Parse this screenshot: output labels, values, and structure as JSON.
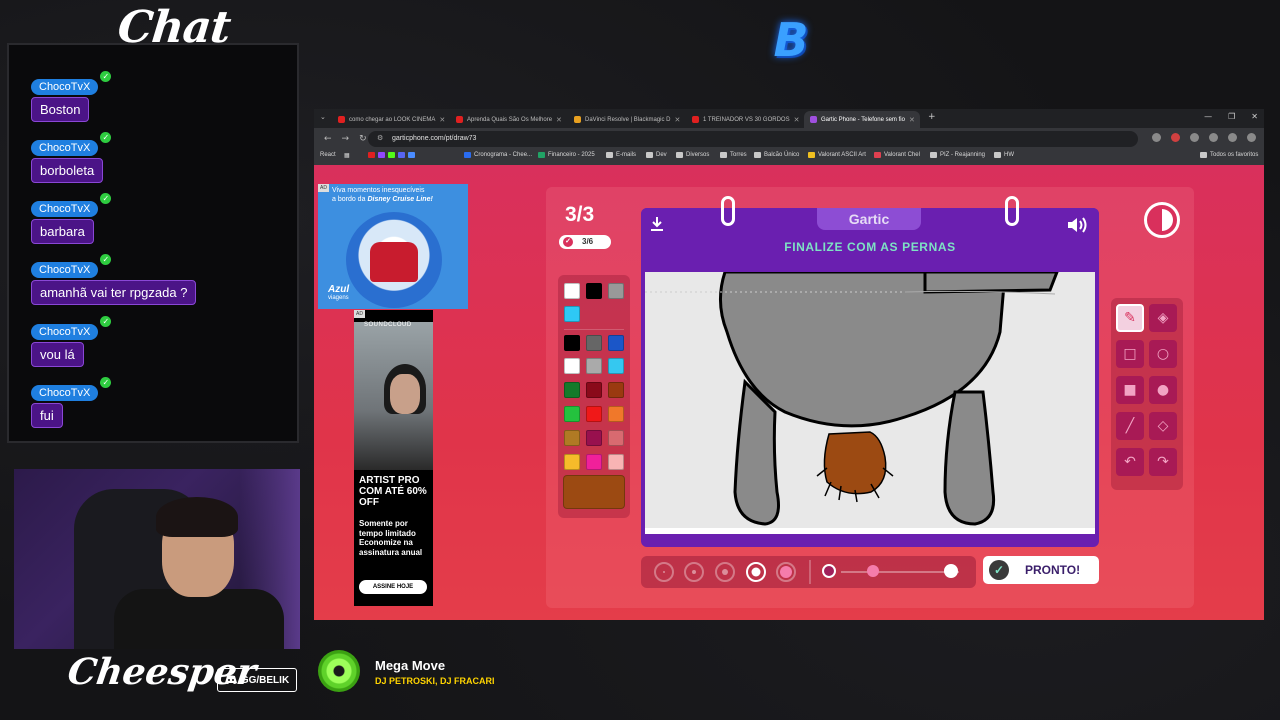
{
  "overlay": {
    "chat_title": "Chat",
    "streamer_name": "Cheesper",
    "discord_label": "GG/BELIK",
    "logo_letter": "B",
    "now_playing": {
      "title": "Mega Move",
      "artist": "DJ PETROSKI, DJ FRACARI"
    }
  },
  "chat": {
    "messages": [
      {
        "user": "ChocoTvX",
        "text": "Boston"
      },
      {
        "user": "ChocoTvX",
        "text": "borboleta"
      },
      {
        "user": "ChocoTvX",
        "text": "barbara"
      },
      {
        "user": "ChocoTvX",
        "text": "amanhã vai ter rpgzada ?"
      },
      {
        "user": "ChocoTvX",
        "text": "vou lá"
      },
      {
        "user": "ChocoTvX",
        "text": "fui"
      }
    ]
  },
  "browser": {
    "tabs": [
      {
        "label": "como chegar ao LOOK CINEMA",
        "favicon_color": "#e02020"
      },
      {
        "label": "Aprenda Quais São Os Melhore",
        "favicon_color": "#e02020"
      },
      {
        "label": "DaVinci Resolve | Blackmagic D",
        "favicon_color": "#e8a020"
      },
      {
        "label": "1 TREINADOR VS 30 GORDOS",
        "favicon_color": "#e02020"
      },
      {
        "label": "Gartic Phone - Telefone sem fio",
        "favicon_color": "#a050e0",
        "active": true
      }
    ],
    "url": "garticphone.com/pt/draw73",
    "bookmarks": [
      "React",
      "Cronograma - Chee...",
      "Financeiro - 2025",
      "E-mails",
      "Dev",
      "Diversos",
      "Torres",
      "Balcão Único",
      "Valorant ASCII Art",
      "Valorant Chel",
      "PIZ - Reajanning",
      "HW",
      "Todos os favoritos"
    ]
  },
  "ads": {
    "ad_tag": "AD",
    "cruise": {
      "text_line1": "Viva momentos inesquecíveis",
      "text_line2": "a bordo da",
      "text_brand": "Disney Cruise Line!",
      "logo_line1": "Azul",
      "logo_line2": "viagens"
    },
    "soundcloud": {
      "brand": "SOUNDCLOUD",
      "headline": "ARTIST PRO COM ATÉ 60% OFF",
      "sub": "Somente por tempo limitado Economize na assinatura anual",
      "cta": "ASSINE HOJE"
    }
  },
  "game": {
    "round": "3/3",
    "progress": "3/6",
    "brand": "Gartic",
    "prompt": "FINALIZE COM AS PERNAS",
    "ready_label": "PRONTO!",
    "palette": [
      "#ffffff",
      "#000000",
      "#999999",
      "#2ec8f5",
      "#000000",
      "#666666",
      "#1b56c8",
      "#ffffff",
      "#aaaaaa",
      "#35c8f0",
      "#147a2a",
      "#8a0a1a",
      "#9a3a10",
      "#24c23e",
      "#f01818",
      "#f0782a",
      "#b07a24",
      "#98104e",
      "#d86a70",
      "#f6bb2a",
      "#f0209a",
      "#f8b4b4"
    ],
    "current_color": "#9c4a12",
    "tools": [
      "pencil-icon",
      "eraser-icon",
      "rect-outline-icon",
      "circle-outline-icon",
      "rect-fill-icon",
      "circle-fill-icon",
      "line-icon",
      "fill-bucket-icon",
      "undo-icon",
      "redo-icon"
    ],
    "brush_size_selected": 4,
    "opacity": 0.3
  }
}
